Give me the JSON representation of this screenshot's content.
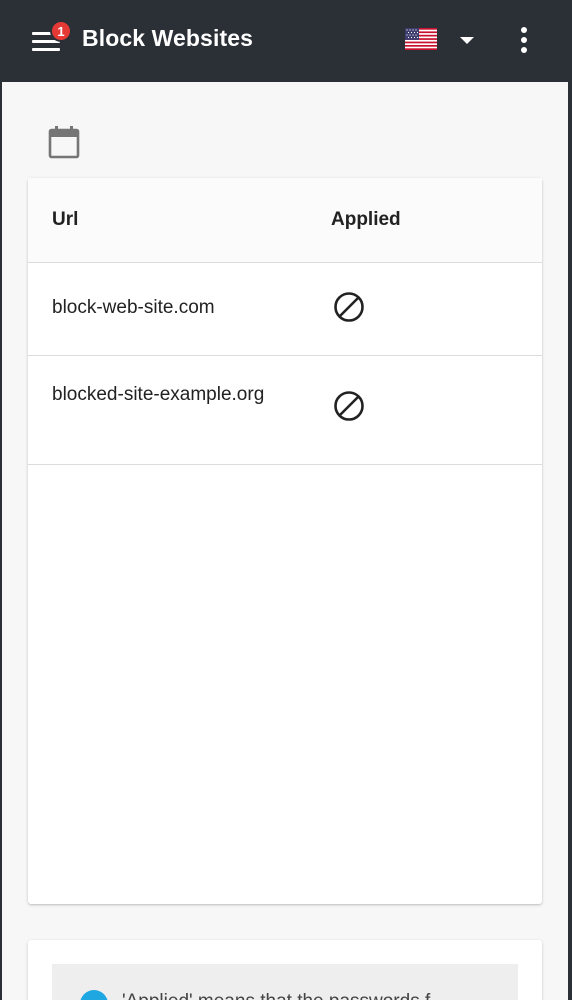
{
  "appbar": {
    "title": "Block Websites",
    "notification_count": "1",
    "menu_icon": "hamburger-icon",
    "language_flag": "us-flag-icon",
    "language_dropdown_icon": "caret-down-icon",
    "more_icon": "more-vert-icon"
  },
  "schedule_icon": "calendar-icon",
  "table": {
    "columns": [
      "Url",
      "Applied"
    ],
    "rows": [
      {
        "url": "block-web-site.com",
        "applied_icon": "block-icon"
      },
      {
        "url": "blocked-site-example.org",
        "applied_icon": "block-icon"
      }
    ]
  },
  "info_note": {
    "icon": "info-icon",
    "text": "'Applied' means that the passwords f"
  },
  "colors": {
    "appbar": "#2b2f36",
    "badge": "#e53935",
    "background": "#f7f7f8",
    "info_accent": "#1ea7e1"
  }
}
